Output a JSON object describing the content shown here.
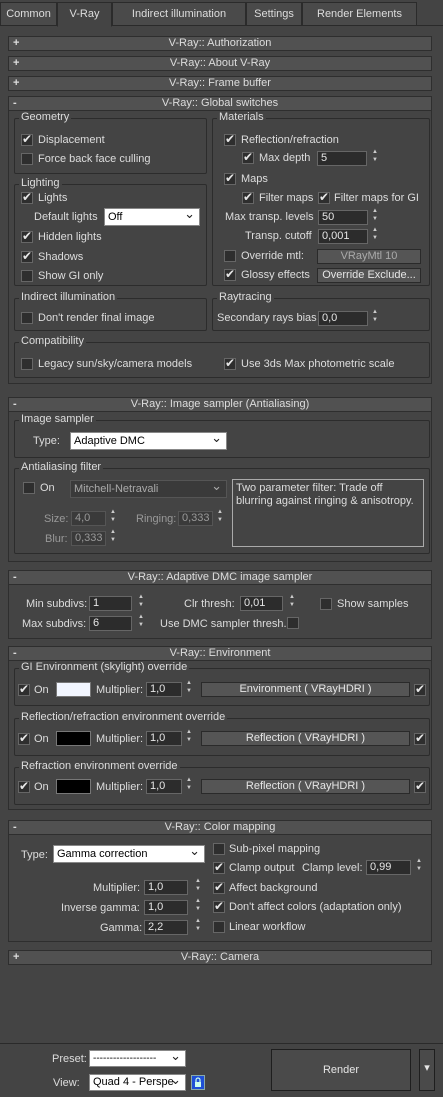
{
  "tabs": [
    "Common",
    "V-Ray",
    "Indirect illumination",
    "Settings",
    "Render Elements"
  ],
  "rollouts": {
    "authorization": "V-Ray:: Authorization",
    "about": "V-Ray:: About V-Ray",
    "frame_buffer": "V-Ray:: Frame buffer",
    "global_switches": "V-Ray:: Global switches",
    "image_sampler": "V-Ray:: Image sampler (Antialiasing)",
    "adaptive_dmc": "V-Ray:: Adaptive DMC image sampler",
    "environment": "V-Ray:: Environment",
    "color_mapping": "V-Ray:: Color mapping",
    "camera": "V-Ray:: Camera"
  },
  "plus": "+",
  "minus": "-",
  "global": {
    "geometry": "Geometry",
    "displacement": "Displacement",
    "force_back": "Force back face culling",
    "lighting": "Lighting",
    "lights": "Lights",
    "default_lights": "Default lights",
    "default_lights_val": "Off",
    "hidden_lights": "Hidden lights",
    "shadows": "Shadows",
    "show_gi": "Show GI only",
    "materials": "Materials",
    "reflection": "Reflection/refraction",
    "max_depth": "Max depth",
    "max_depth_val": "5",
    "maps": "Maps",
    "filter_maps": "Filter maps",
    "filter_maps_gi": "Filter maps for GI",
    "max_transp": "Max transp. levels",
    "max_transp_val": "50",
    "transp_cutoff": "Transp. cutoff",
    "transp_cutoff_val": "0,001",
    "override_mtl": "Override mtl:",
    "override_mtl_btn": "VRayMtl 10",
    "glossy": "Glossy effects",
    "override_exclude": "Override Exclude...",
    "indirect": "Indirect illumination",
    "dont_render": "Don't render final image",
    "raytracing": "Raytracing",
    "secondary_bias": "Secondary rays bias",
    "secondary_bias_val": "0,0",
    "compat": "Compatibility",
    "legacy": "Legacy sun/sky/camera models",
    "photometric": "Use 3ds Max photometric scale"
  },
  "sampler": {
    "image_sampler": "Image sampler",
    "type": "Type:",
    "type_val": "Adaptive DMC",
    "aa_filter": "Antialiasing filter",
    "on": "On",
    "filter_val": "Mitchell-Netravali",
    "size": "Size:",
    "size_val": "4,0",
    "ringing": "Ringing:",
    "ringing_val": "0,333",
    "blur": "Blur:",
    "blur_val": "0,333",
    "desc": "Two parameter filter: Trade off blurring against ringing & anisotropy."
  },
  "dmc": {
    "min_subdivs": "Min subdivs:",
    "min_val": "1",
    "max_subdivs": "Max subdivs:",
    "max_val": "6",
    "clr_thresh": "Clr thresh:",
    "clr_val": "0,01",
    "use_dmc": "Use DMC sampler thresh.",
    "show_samples": "Show samples"
  },
  "env": {
    "gi_title": "GI Environment (skylight) override",
    "refl_title": "Reflection/refraction environment override",
    "refr_title": "Refraction environment override",
    "on": "On",
    "multiplier": "Multiplier:",
    "mult_val": "1,0",
    "gi_map": "Environment  ( VRayHDRI )",
    "refl_map": "Reflection  ( VRayHDRI )",
    "refr_map": "Reflection  ( VRayHDRI )",
    "gi_color": "#f2f6ff",
    "refl_color": "#000000"
  },
  "cm": {
    "type": "Type:",
    "type_val": "Gamma correction",
    "subpixel": "Sub-pixel mapping",
    "clamp": "Clamp output",
    "clamp_level": "Clamp level:",
    "clamp_val": "0,99",
    "affect_bg": "Affect background",
    "dont_affect": "Don't affect colors (adaptation only)",
    "linear": "Linear workflow",
    "multiplier": "Multiplier:",
    "mult_val": "1,0",
    "inv_gamma": "Inverse gamma:",
    "inv_val": "1,0",
    "gamma": "Gamma:",
    "gamma_val": "2,2"
  },
  "bottom": {
    "preset": "Preset:",
    "preset_val": "-------------------",
    "view": "View:",
    "view_val": "Quad 4 - Perspe",
    "render": "Render",
    "lock_icon": "lock-icon"
  }
}
